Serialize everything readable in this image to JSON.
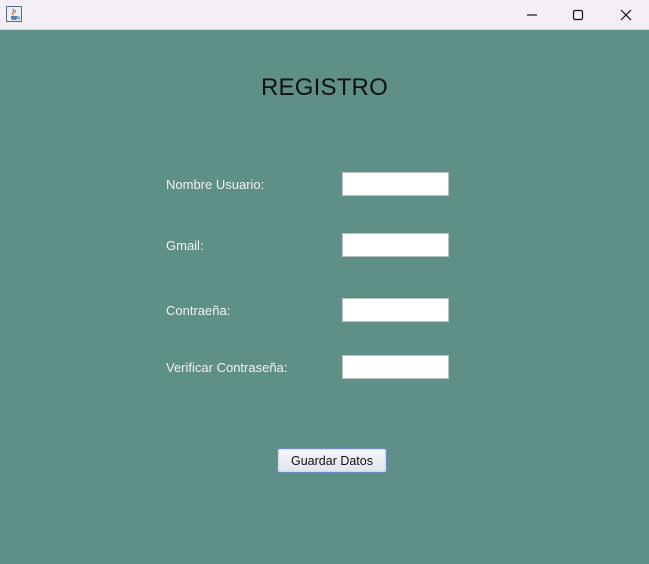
{
  "window": {
    "app_icon": "java-cup-icon",
    "controls": [
      "minimize-icon",
      "maximize-icon",
      "close-icon"
    ]
  },
  "form": {
    "title": "REGISTRO",
    "fields": [
      {
        "label": "Nombre Usuario:",
        "value": ""
      },
      {
        "label": "Gmail:",
        "value": ""
      },
      {
        "label": "Contraeña:",
        "value": ""
      },
      {
        "label": "Verificar Contraseña:",
        "value": ""
      }
    ],
    "submit_label": "Guardar Datos"
  },
  "colors": {
    "background": "#5e9087",
    "titlebar": "#f3eff4",
    "label_text": "#f2f2f2",
    "button_border": "#6d8fc6"
  }
}
